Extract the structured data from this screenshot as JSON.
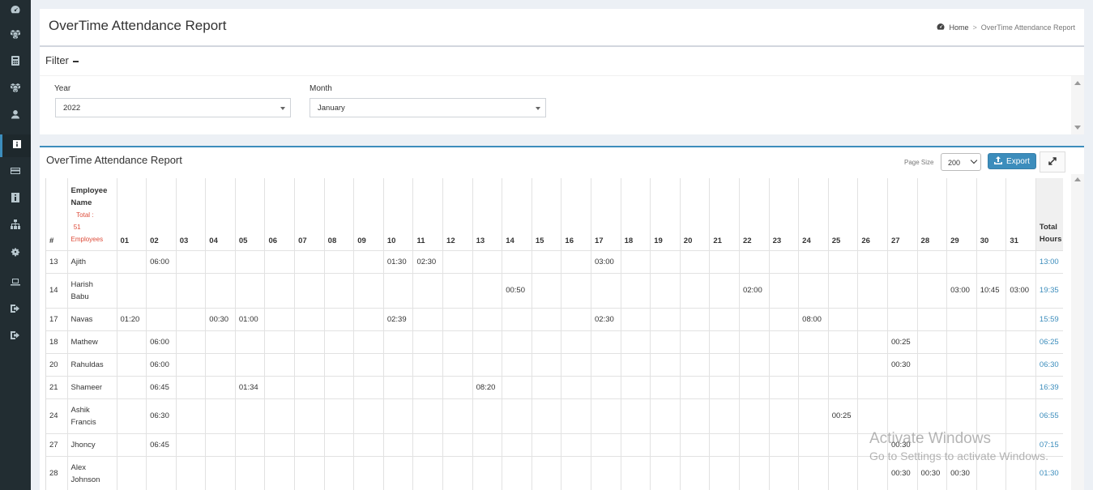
{
  "sidebar": {
    "items": [
      {
        "icon": "dashboard-icon",
        "top": 0
      },
      {
        "icon": "cubes-icon"
      },
      {
        "icon": "calculator-icon"
      },
      {
        "icon": "cubes-icon"
      },
      {
        "icon": "user-icon"
      },
      {
        "icon": "report-icon",
        "active": true
      },
      {
        "icon": "credit-card-icon"
      },
      {
        "icon": "id-card-icon"
      },
      {
        "icon": "sitemap-icon"
      },
      {
        "icon": "cogs-icon"
      },
      {
        "icon": "laptop-icon"
      },
      {
        "icon": "sign-out-icon"
      },
      {
        "icon": "sign-out-icon"
      }
    ]
  },
  "header": {
    "title": "OverTime Attendance Report",
    "breadcrumb_home": "Home",
    "breadcrumb_sep": ">",
    "breadcrumb_current": "OverTime Attendance Report"
  },
  "filter": {
    "title": "Filter",
    "year_label": "Year",
    "year_value": "2022",
    "month_label": "Month",
    "month_value": "January"
  },
  "report": {
    "title": "OverTime Attendance Report",
    "page_size_label": "Page Size",
    "page_size_value": "200",
    "export_label": "Export"
  },
  "table": {
    "col_hash": "#",
    "col_name": "Employee Name",
    "col_total_line1": "Total :",
    "col_total_line2": "51",
    "col_total_line3": "Employees",
    "col_total_hours": "Total Hours",
    "days": [
      "01",
      "02",
      "03",
      "04",
      "05",
      "06",
      "07",
      "08",
      "09",
      "10",
      "11",
      "12",
      "13",
      "14",
      "15",
      "16",
      "17",
      "18",
      "19",
      "20",
      "21",
      "22",
      "23",
      "24",
      "25",
      "26",
      "27",
      "28",
      "29",
      "30",
      "31"
    ],
    "rows": [
      {
        "id": "13",
        "name": "Ajith",
        "tall": false,
        "cells": {
          "02": "06:00",
          "10": "01:30",
          "11": "02:30",
          "17": "03:00"
        },
        "total": "13:00"
      },
      {
        "id": "14",
        "name": "Harish Babu",
        "tall": true,
        "cells": {
          "14": "00:50",
          "22": "02:00",
          "29": "03:00",
          "30": "10:45",
          "31": "03:00"
        },
        "total": "19:35"
      },
      {
        "id": "17",
        "name": "Navas",
        "tall": false,
        "cells": {
          "01": "01:20",
          "04": "00:30",
          "05": "01:00",
          "10": "02:39",
          "17": "02:30",
          "24": "08:00"
        },
        "total": "15:59"
      },
      {
        "id": "18",
        "name": "Mathew",
        "tall": false,
        "cells": {
          "02": "06:00",
          "27": "00:25"
        },
        "total": "06:25"
      },
      {
        "id": "20",
        "name": "Rahuldas",
        "tall": false,
        "cells": {
          "02": "06:00",
          "27": "00:30"
        },
        "total": "06:30"
      },
      {
        "id": "21",
        "name": "Shameer",
        "tall": false,
        "cells": {
          "02": "06:45",
          "05": "01:34",
          "13": "08:20"
        },
        "total": "16:39"
      },
      {
        "id": "24",
        "name": "Ashik Francis",
        "tall": true,
        "cells": {
          "02": "06:30",
          "25": "00:25"
        },
        "total": "06:55"
      },
      {
        "id": "27",
        "name": "Jhoncy",
        "tall": false,
        "cells": {
          "02": "06:45",
          "27": "00:30"
        },
        "total": "07:15"
      },
      {
        "id": "28",
        "name": "Alex Johnson",
        "tall": true,
        "cells": {
          "27": "00:30",
          "28": "00:30",
          "29": "00:30"
        },
        "total": "01:30"
      }
    ]
  },
  "watermark": {
    "line1": "Activate Windows",
    "line2": "Go to Settings to activate Windows."
  },
  "colors": {
    "sidebar": "#222d32",
    "accent": "#3c8dbc",
    "danger": "#dd4b39"
  }
}
